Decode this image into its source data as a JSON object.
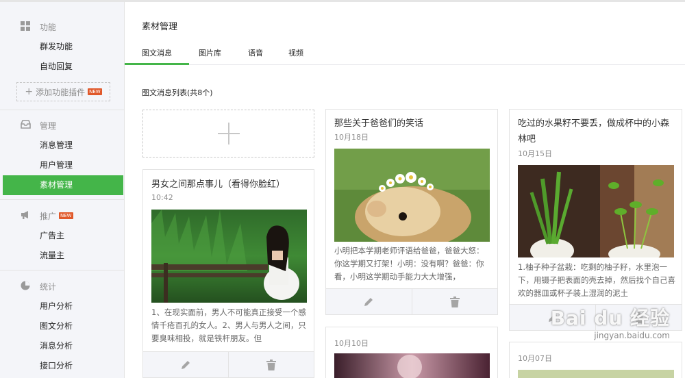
{
  "sidebar": {
    "features": {
      "header": "功能",
      "items": [
        "群发功能",
        "自动回复"
      ],
      "add_plugin": "添加功能插件",
      "new_badge": "NEW"
    },
    "manage": {
      "header": "管理",
      "items": [
        "消息管理",
        "用户管理",
        "素材管理"
      ]
    },
    "promote": {
      "header": "推广",
      "new_badge": "NEW",
      "items": [
        "广告主",
        "流量主"
      ]
    },
    "stats": {
      "header": "统计",
      "items": [
        "用户分析",
        "图文分析",
        "消息分析",
        "接口分析"
      ]
    }
  },
  "main": {
    "page_title": "素材管理",
    "tabs": [
      "图文消息",
      "图片库",
      "语音",
      "视频"
    ],
    "active_tab": "图文消息",
    "list_title": "图文消息列表(共8个)"
  },
  "cards": [
    {
      "title": "男女之间那点事儿（看得你脸红）",
      "date": "10:42",
      "desc": "1、在现实面前，男人不可能真正接受一个感情千疮百孔的女人。2、男人与男人之间，只要臭味相投，就是铁杆朋友。但"
    },
    {
      "title": "那些关于爸爸们的笑话",
      "date": "10月18日",
      "desc": "小明把本学期老师评语给爸爸，爸爸大怒：你这学期又打架！小明：没有啊？爸爸：你看，小明这学期动手能力大大增强，"
    },
    {
      "title": "吃过的水果籽不要丢，做成杯中的小森林吧",
      "date": "10月15日",
      "desc": "1.柚子种子盆栽：吃剩的柚子籽，水里泡一下，用镊子把表面的壳去掉，然后找个自己喜欢的器皿或杯子装上湿润的泥土"
    },
    {
      "title": "",
      "date": "10月10日",
      "desc": ""
    },
    {
      "title": "",
      "date": "10月07日",
      "desc": ""
    }
  ],
  "watermark": {
    "text": "Bai du 经验",
    "url": "jingyan.baidu.com"
  },
  "colors": {
    "accent": "#44b549",
    "sidebar_bg": "#f4f5f9",
    "card_footer_bg": "#f4f5f9"
  }
}
